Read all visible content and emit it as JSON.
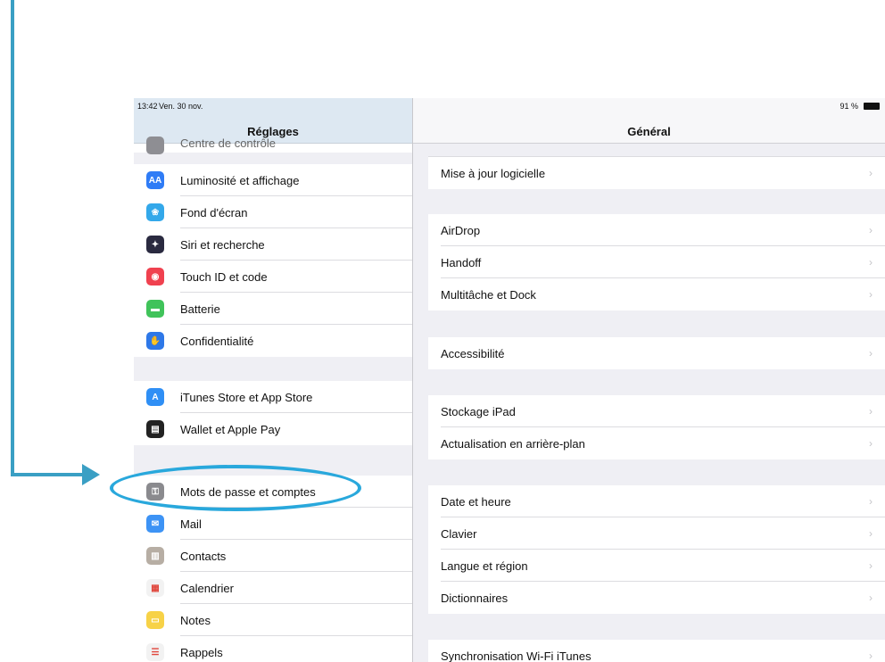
{
  "status_bar": {
    "time": "13:42",
    "date": "Ven. 30 nov.",
    "battery_percent": "91 %"
  },
  "master": {
    "title": "Réglages",
    "partial_item": {
      "label": "Centre de contrôle",
      "icon": "control-center-icon",
      "color": "#8e8e93"
    },
    "groups": [
      [
        {
          "label": "Luminosité et affichage",
          "icon": "display-brightness-icon",
          "glyph": "AA",
          "color": "#2f7cf6"
        },
        {
          "label": "Fond d'écran",
          "icon": "wallpaper-icon",
          "glyph": "❀",
          "color": "#33a8ea"
        },
        {
          "label": "Siri et recherche",
          "icon": "siri-icon",
          "glyph": "✦",
          "color": "#2a2a40"
        },
        {
          "label": "Touch ID et code",
          "icon": "fingerprint-icon",
          "glyph": "◉",
          "color": "#f0414f"
        },
        {
          "label": "Batterie",
          "icon": "battery-icon",
          "glyph": "▬",
          "color": "#40c35a"
        },
        {
          "label": "Confidentialité",
          "icon": "privacy-hand-icon",
          "glyph": "✋",
          "color": "#2e78e8"
        }
      ],
      [
        {
          "label": "iTunes Store et App Store",
          "icon": "app-store-icon",
          "glyph": "A",
          "color": "#2f8ff5"
        },
        {
          "label": "Wallet et Apple Pay",
          "icon": "wallet-icon",
          "glyph": "▤",
          "color": "#222222"
        }
      ],
      [
        {
          "label": "Mots de passe et comptes",
          "icon": "key-icon",
          "glyph": "⚿",
          "color": "#8a8a8e"
        },
        {
          "label": "Mail",
          "icon": "mail-icon",
          "glyph": "✉",
          "color": "#3d93f5"
        },
        {
          "label": "Contacts",
          "icon": "contacts-icon",
          "glyph": "▥",
          "color": "#b7aea4"
        },
        {
          "label": "Calendrier",
          "icon": "calendar-icon",
          "glyph": "▦",
          "color": "#f2f2f2"
        },
        {
          "label": "Notes",
          "icon": "notes-icon",
          "glyph": "▭",
          "color": "#f7d247"
        },
        {
          "label": "Rappels",
          "icon": "reminders-icon",
          "glyph": "☰",
          "color": "#f2f2f2"
        }
      ]
    ]
  },
  "detail": {
    "title": "Général",
    "groups": [
      [
        {
          "label": "Mise à jour logicielle"
        }
      ],
      [
        {
          "label": "AirDrop"
        },
        {
          "label": "Handoff"
        },
        {
          "label": "Multitâche et Dock"
        }
      ],
      [
        {
          "label": "Accessibilité"
        }
      ],
      [
        {
          "label": "Stockage iPad"
        },
        {
          "label": "Actualisation en arrière-plan"
        }
      ],
      [
        {
          "label": "Date et heure"
        },
        {
          "label": "Clavier"
        },
        {
          "label": "Langue et région"
        },
        {
          "label": "Dictionnaires"
        }
      ],
      [
        {
          "label": "Synchronisation Wi-Fi iTunes"
        }
      ]
    ],
    "chevron": "›"
  },
  "annotation": {
    "color": "#3a9fc4",
    "highlight_color": "#29a8dc"
  }
}
